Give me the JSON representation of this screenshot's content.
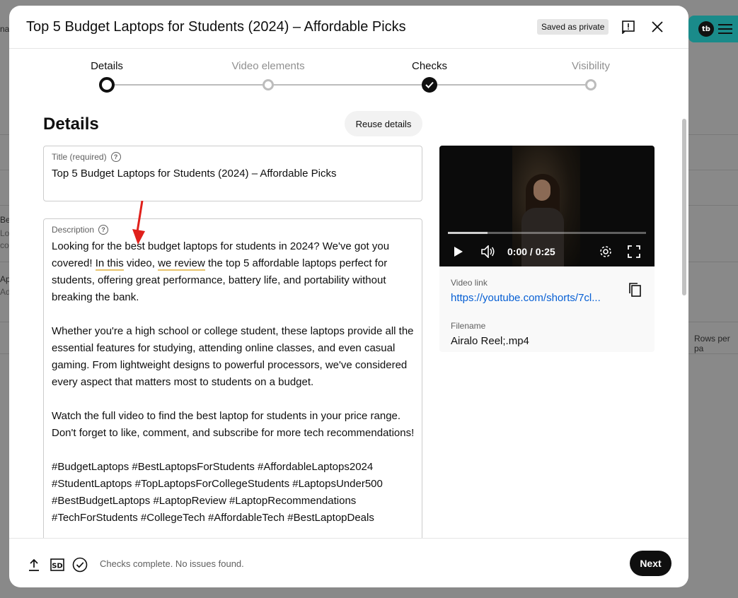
{
  "background": {
    "fragments": [
      "na",
      "Be",
      "Lo",
      "co",
      "Ap",
      "Ad",
      "Rows per pa"
    ]
  },
  "header": {
    "title": "Top 5 Budget Laptops for Students (2024) – Affordable Picks",
    "saved_badge": "Saved as private",
    "feedback_icon": "feedback-icon",
    "close_icon": "close-icon"
  },
  "stepper": {
    "steps": [
      {
        "label": "Details",
        "state": "current"
      },
      {
        "label": "Video elements",
        "state": "pending"
      },
      {
        "label": "Checks",
        "state": "complete"
      },
      {
        "label": "Visibility",
        "state": "pending"
      }
    ]
  },
  "details": {
    "section_title": "Details",
    "reuse_button": "Reuse details",
    "title_field": {
      "label": "Title (required)",
      "value": "Top 5 Budget Laptops for Students (2024) – Affordable Picks"
    },
    "description_field": {
      "label": "Description",
      "p1_a": "Looking for the best budget laptops for students in 2024? We've got you covered! ",
      "p1_u1": "In this",
      "p1_b": " video, ",
      "p1_u2": "we review",
      "p1_c": " the top 5 affordable laptops perfect for students, offering great performance, battery life, and portability without breaking the bank.",
      "p2": "Whether you're a high school or college student, these laptops provide all the essential features for studying, attending online classes, and even casual gaming. From lightweight designs to powerful processors, we've considered every aspect that matters most to students on a budget.",
      "p3": "Watch the full video to find the best laptop for students in your price range. Don't forget to like, comment, and subscribe for more tech recommendations!",
      "p4": "#BudgetLaptops #BestLaptopsForStudents #AffordableLaptops2024 #StudentLaptops #TopLaptopsForCollegeStudents #LaptopsUnder500 #BestBudgetLaptops #LaptopReview #LaptopRecommendations #TechForStudents #CollegeTech #AffordableTech #BestLaptopDeals"
    }
  },
  "video": {
    "time": "0:00 / 0:25",
    "progress_fraction": 0.2,
    "link_label": "Video link",
    "link": "https://youtube.com/shorts/7cl...",
    "filename_label": "Filename",
    "filename": "Airalo Reel;.mp4"
  },
  "footer": {
    "quality_badge": "SD",
    "status": "Checks complete. No issues found.",
    "next_button": "Next"
  },
  "colors": {
    "accent_link": "#065fd4",
    "brand_teal": "#1a8b8a",
    "annotation_red": "#e0201b",
    "squiggle": "#e8c36b"
  }
}
